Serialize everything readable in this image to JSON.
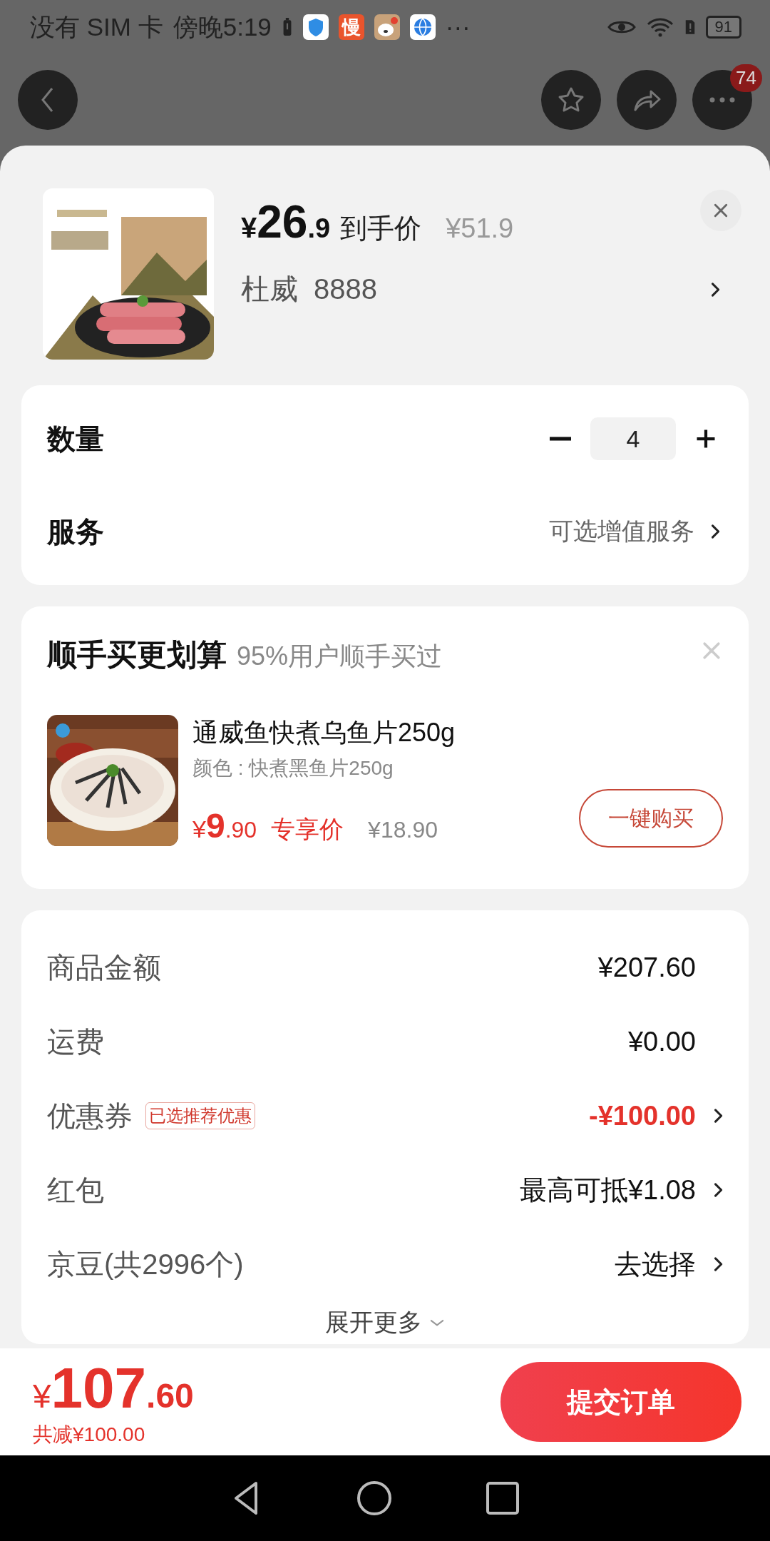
{
  "status_bar": {
    "carrier": "没有 SIM 卡",
    "time": "傍晚5:19",
    "app_icons": [
      {
        "kind": "shield"
      },
      {
        "kind": "text",
        "label": "慢"
      },
      {
        "kind": "mascot"
      },
      {
        "kind": "globe"
      }
    ],
    "more": "···",
    "battery": "91"
  },
  "nav": {
    "badge": "74"
  },
  "product": {
    "price": {
      "symbol": "¥",
      "integer": "26",
      "fraction": ".9"
    },
    "price_label": "到手价",
    "original_price": "¥51.9",
    "variant": "杜威",
    "variant_code": "8888"
  },
  "options": {
    "quantity": {
      "label": "数量",
      "value": "4"
    },
    "service": {
      "label": "服务",
      "value": "可选增值服务"
    }
  },
  "upsell": {
    "title": "顺手买更划算",
    "subtitle": "95%用户顺手买过",
    "item": {
      "name": "通威鱼快煮乌鱼片250g",
      "spec": "颜色 : 快煮黑鱼片250g",
      "price": {
        "symbol": "¥",
        "integer": "9",
        "fraction": ".90"
      },
      "price_label": "专享价",
      "original_price": "¥18.90",
      "button": "一键购买"
    }
  },
  "summary": {
    "rows": [
      {
        "label": "商品金额",
        "value": "¥207.60",
        "highlight": false,
        "chevron": false
      },
      {
        "label": "运费",
        "value": "¥0.00",
        "highlight": false,
        "chevron": false
      },
      {
        "label": "优惠券",
        "tag": "已选推荐优惠",
        "value": "-¥100.00",
        "highlight": true,
        "chevron": true
      },
      {
        "label": "红包",
        "value": "最高可抵¥1.08",
        "highlight": false,
        "chevron": true
      },
      {
        "label": "京豆(共2996个)",
        "value": "去选择",
        "highlight": false,
        "chevron": true
      }
    ],
    "expand": "展开更多"
  },
  "footer": {
    "total": {
      "symbol": "¥",
      "integer": "107",
      "fraction": ".60"
    },
    "discount": "共减¥100.00",
    "submit": "提交订单"
  }
}
